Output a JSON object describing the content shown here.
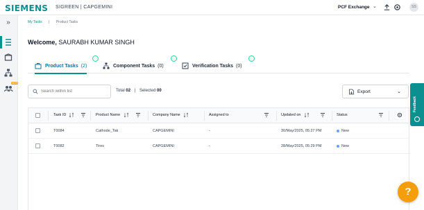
{
  "header": {
    "logo": "SIEMENS",
    "app_name": "SIGREEN | CAPGEMINI",
    "pcf_menu": "PCF Exchange",
    "avatar_initials": "SS"
  },
  "breadcrumb": [
    "My Tasks",
    "Product Tasks"
  ],
  "welcome": {
    "prefix": "Welcome,",
    "user": "SAURABH KUMAR SINGH"
  },
  "sidebar": {
    "new_badge": "NEW"
  },
  "tabs": [
    {
      "label": "Product Tasks",
      "count": "(2)",
      "active": true
    },
    {
      "label": "Component Tasks",
      "count": "(0)",
      "active": false
    },
    {
      "label": "Verification Tasks",
      "count": "(0)",
      "active": false
    }
  ],
  "toolbar": {
    "search_placeholder": "Search within list",
    "total_label": "Total",
    "total_value": "02",
    "selected_label": "Selected",
    "selected_value": "00",
    "export_label": "Export"
  },
  "feedback_label": "Feedback",
  "table": {
    "columns": [
      "Task ID",
      "Product Name",
      "Company Name",
      "Assigned to",
      "Updated on",
      "Status"
    ],
    "rows": [
      {
        "task_id": "T0084",
        "product": "Cathode_Tak",
        "company": "CAPGEMINI",
        "assigned": "-",
        "updated": "30/May/2025, 05:27 PM",
        "status": "New"
      },
      {
        "task_id": "T0082",
        "product": "Tires",
        "company": "CAPGEMINI",
        "assigned": "-",
        "updated": "28/May/2025, 05:29 PM",
        "status": "New"
      }
    ]
  },
  "help_label": "?",
  "colors": {
    "accent": "#0b8f8f",
    "tab_active_text": "#0b6f9f",
    "help_button": "#f59e0b",
    "status_new": "#60a5fa"
  }
}
